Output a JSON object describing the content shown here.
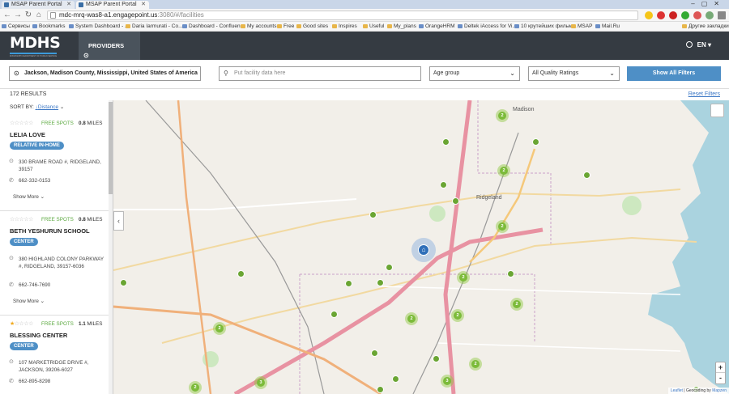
{
  "browser": {
    "tabs": [
      "MSAP Parent Portal",
      "MSAP Parent Portal"
    ],
    "url_host": "mdc-mrq-was8-a1.engagepoint.us",
    "url_path": ":3080/#/facilities",
    "bookmarks": [
      "Сервисы",
      "Bookmarks",
      "System Dashboard - ...",
      "Daria Iarmurati - Co...",
      "Dashboard - Confluen...",
      "My accounts",
      "Free",
      "Good sites",
      "Inspires",
      "Useful",
      "My_plans",
      "OrangeHRM",
      "Deltek iAccess for Vi...",
      "10 крутейших фильм...",
      "MSAP",
      "Mail.Ru",
      "Другие закладки"
    ]
  },
  "header": {
    "logo": "MDHS",
    "logo_sub": "MISSISSIPPI DEPARTMENT OF HUMAN SERVICES",
    "nav_providers": "PROVIDERS",
    "language": "EN"
  },
  "search": {
    "location_value": "Jackson, Madison County, Mississippi, United States of America",
    "facility_placeholder": "Put facility data here",
    "age_group": "Age group",
    "quality": "All Quality Ratings",
    "show_filters": "Show All Filters"
  },
  "results": {
    "count": "172 RESULTS",
    "reset": "Reset Filters",
    "sort_label": "SORT BY:",
    "sort_value": "Distance"
  },
  "facilities": [
    {
      "stars": 0,
      "spots": "FREE SPOTS",
      "miles_value": "0.8",
      "miles_unit": "MILES",
      "name": "LELIA LOVE",
      "type": "RELATIVE IN-HOME",
      "address": "330 BRAME ROAD #, RIDGELAND, 39157",
      "phone": "662-332-0153",
      "more": "Show More"
    },
    {
      "stars": 0,
      "spots": "FREE SPOTS",
      "miles_value": "0.8",
      "miles_unit": "MILES",
      "name": "BETH YESHURUN SCHOOL",
      "type": "CENTER",
      "address": "380 HIGHLAND COLONY PARKWAY #, RIDGELAND, 39157-6036",
      "phone": "662-746-7690",
      "more": "Show More"
    },
    {
      "stars": 1,
      "spots": "FREE SPOTS",
      "miles_value": "1.1",
      "miles_unit": "MILES",
      "name": "BLESSING CENTER",
      "type": "CENTER",
      "address": "107 MARKETRIDGE DRIVE #, JACKSON, 39206-6027",
      "phone": "662-895-8298",
      "more": "Show More"
    }
  ],
  "map": {
    "places": [
      "Madison",
      "Ridgeland"
    ],
    "attribution_leaflet": "Leaflet",
    "attribution_text": " | Geocoding by ",
    "attribution_mapzen": "Mapzen",
    "zoom_in": "+",
    "zoom_out": "-",
    "clusters": [
      "2",
      "2",
      "2",
      "2",
      "2",
      "2",
      "2",
      "2",
      "2",
      "2",
      "3",
      "3",
      "2",
      "3"
    ]
  }
}
